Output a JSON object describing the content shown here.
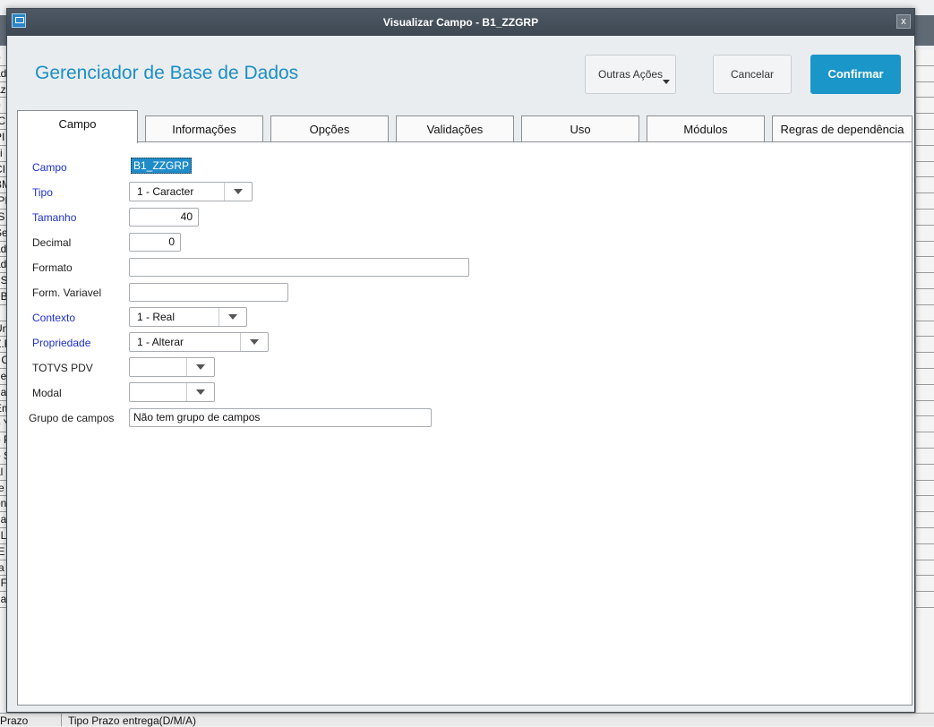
{
  "background": {
    "left_rows": [
      "o",
      "ad",
      "az",
      "o",
      "IC",
      "PI",
      "ci",
      "CI",
      "BM",
      "IPI",
      "IS",
      "Se",
      "ad",
      "ad",
      ". S",
      ". B",
      "",
      "Un",
      "Z.F",
      "r C",
      "de",
      "na",
      "Em",
      "o Y",
      "o P",
      "o S",
      "al",
      "re",
      "on",
      "da",
      ". L",
      ".E",
      "ra",
      ". F",
      "ga"
    ],
    "bottom_col1": "Prazo",
    "bottom_col2": "Tipo Prazo entrega(D/M/A)"
  },
  "window": {
    "title": "Visualizar Campo - B1_ZZGRP",
    "close_label": "x"
  },
  "header": {
    "title": "Gerenciador de Base de Dados",
    "btn_outras": "Outras Ações",
    "btn_cancelar": "Cancelar",
    "btn_confirmar": "Confirmar"
  },
  "tabs": [
    {
      "label": "Campo"
    },
    {
      "label": "Informações"
    },
    {
      "label": "Opções"
    },
    {
      "label": "Validações"
    },
    {
      "label": "Uso"
    },
    {
      "label": "Módulos"
    },
    {
      "label": "Regras de dependência"
    }
  ],
  "form": {
    "campo": {
      "label": "Campo",
      "value": "B1_ZZGRP"
    },
    "tipo": {
      "label": "Tipo",
      "value": "1 - Caracter"
    },
    "tamanho": {
      "label": "Tamanho",
      "value": "40"
    },
    "decimal": {
      "label": "Decimal",
      "value": "0"
    },
    "formato": {
      "label": "Formato",
      "value": ""
    },
    "form_variavel": {
      "label": "Form. Variavel",
      "value": ""
    },
    "contexto": {
      "label": "Contexto",
      "value": "1 - Real"
    },
    "propriedade": {
      "label": "Propriedade",
      "value": "1 - Alterar"
    },
    "totvs_pdv": {
      "label": "TOTVS PDV",
      "value": ""
    },
    "modal": {
      "label": "Modal",
      "value": ""
    },
    "grupo_campos": {
      "label": "Grupo de campos",
      "value": "Não tem grupo de campos"
    }
  },
  "colors": {
    "accent": "#1b96c9",
    "title_blue": "#1a8fc4",
    "required_label": "#1f2ecc",
    "titlebar": "#46515c"
  }
}
